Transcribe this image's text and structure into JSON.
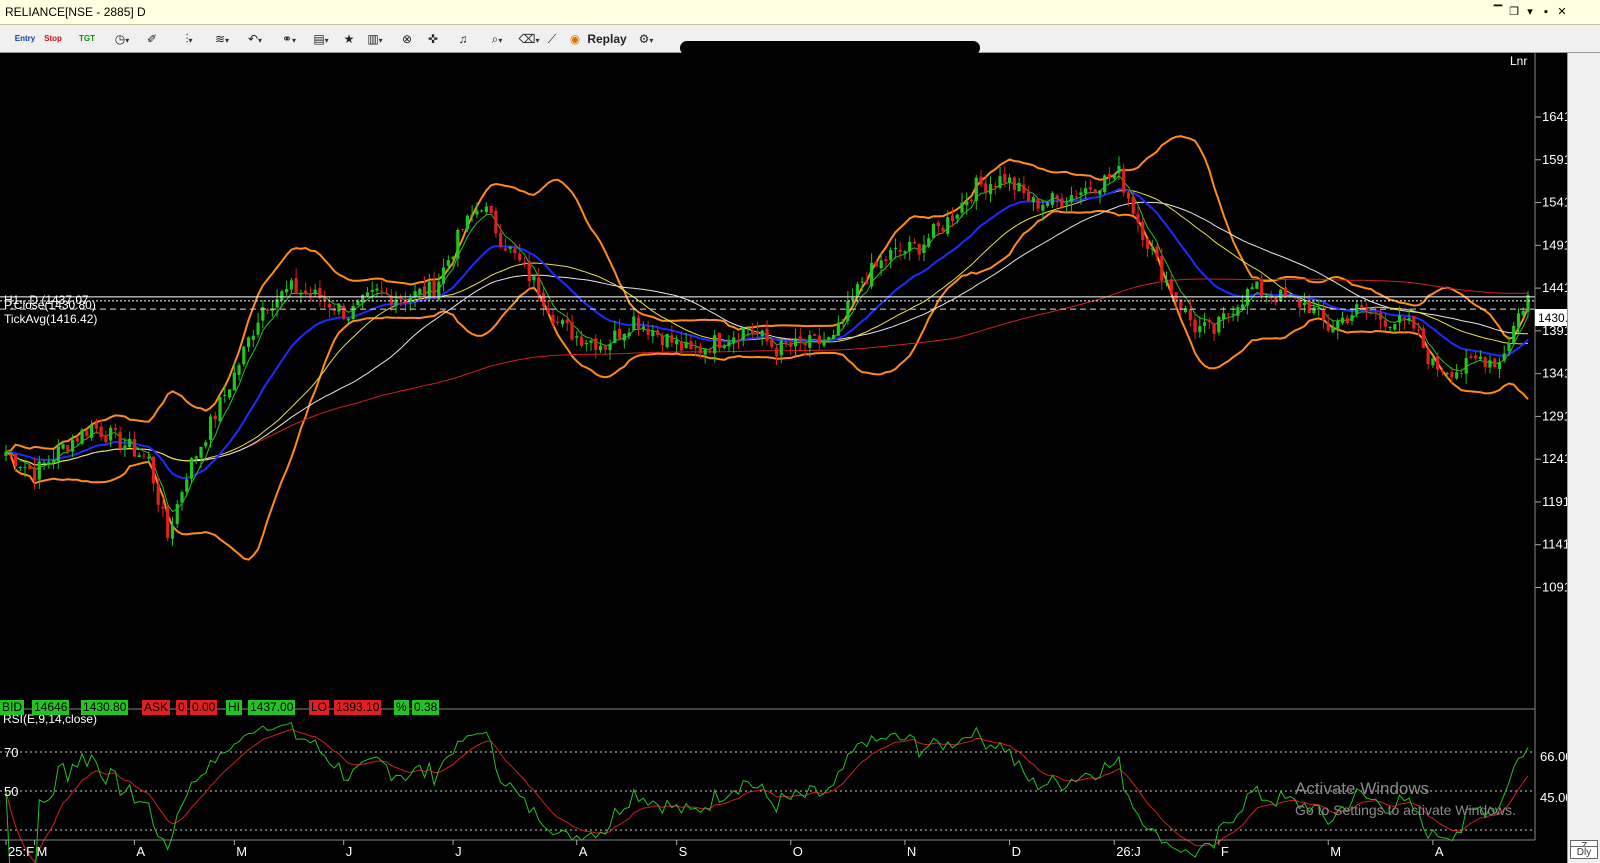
{
  "window": {
    "title": "RELIANCE[NSE - 2885] D"
  },
  "toolbar": {
    "entry_label": "Entry",
    "stop_label": "Stop",
    "tgt_label": "TGT",
    "replay_label": "Replay"
  },
  "chart_header": {
    "scale_mode": "Lnr",
    "hl_label": "H1...D (1437.07",
    "pclose_label": "P.Close(1430.80)",
    "tickavg_label": "TickAvg(1416.42)",
    "last_price_tag": "1430.80"
  },
  "quote_bar": {
    "bid_label": "BID",
    "bid_qty": "14646",
    "bid_price": "1430.80",
    "ask_label": "ASK",
    "ask_qty": "0",
    "ask_price": "0.00",
    "hi_label": "HI",
    "hi_value": "1437.00",
    "lo_label": "LO",
    "lo_value": "1393.10",
    "pct_label": "%",
    "pct_value": "0.38"
  },
  "rsi_panel": {
    "title": "RSI(E,9,14,close)",
    "left_levels": [
      "70",
      "50"
    ],
    "right_levels": [
      "66.00",
      "45.00"
    ]
  },
  "watermark": {
    "line1": "Activate Windows",
    "line2": "Go to Settings to activate Windows."
  },
  "right_strip": {
    "zoom_icon": "Z",
    "period_label": "Dly"
  },
  "colors": {
    "up_candle": "#22c322",
    "down_candle": "#e02020",
    "bollinger": "#ff8c1a",
    "ema_fast": "#1e2bff",
    "sma_long": "#d02020",
    "ma_yellow": "#e8e040",
    "ma_white": "#e6e6e6",
    "rsi_line": "#22c322",
    "rsi_signal": "#d02020"
  },
  "chart_data": {
    "type": "candlestick",
    "symbol": "RELIANCE",
    "timeframe": "Daily",
    "price_axis_ticks": [
      1641,
      1591,
      1541,
      1491,
      1441,
      1391,
      1341,
      1291,
      1241,
      1191,
      1141,
      1091
    ],
    "price_axis_labels": [
      "1641.00",
      "1591.00",
      "1541.00",
      "1491.00",
      "1441.00",
      "1391.00",
      "1341.00",
      "1291.00",
      "1241.00",
      "1191.00",
      "1141.00",
      "1091.00"
    ],
    "ylim": [
      1030,
      1700
    ],
    "time_axis_labels": [
      "25:F",
      "M",
      "A",
      "M",
      "J",
      "J",
      "A",
      "S",
      "O",
      "N",
      "D",
      "26:J",
      "F",
      "M",
      "A"
    ],
    "time_axis_label_index": [
      0,
      6,
      27,
      48,
      71,
      94,
      120,
      141,
      165,
      189,
      211,
      233,
      255,
      278,
      300
    ],
    "close_path": [
      [
        0,
        1250
      ],
      [
        6,
        1225
      ],
      [
        12,
        1255
      ],
      [
        18,
        1280
      ],
      [
        24,
        1262
      ],
      [
        30,
        1240
      ],
      [
        34,
        1150
      ],
      [
        38,
        1225
      ],
      [
        42,
        1270
      ],
      [
        48,
        1340
      ],
      [
        54,
        1420
      ],
      [
        60,
        1440
      ],
      [
        66,
        1430
      ],
      [
        72,
        1410
      ],
      [
        78,
        1435
      ],
      [
        84,
        1430
      ],
      [
        90,
        1440
      ],
      [
        96,
        1510
      ],
      [
        100,
        1540
      ],
      [
        104,
        1500
      ],
      [
        108,
        1470
      ],
      [
        112,
        1440
      ],
      [
        116,
        1400
      ],
      [
        120,
        1385
      ],
      [
        126,
        1375
      ],
      [
        132,
        1405
      ],
      [
        138,
        1385
      ],
      [
        144,
        1365
      ],
      [
        150,
        1380
      ],
      [
        156,
        1395
      ],
      [
        162,
        1370
      ],
      [
        168,
        1375
      ],
      [
        174,
        1380
      ],
      [
        180,
        1450
      ],
      [
        186,
        1480
      ],
      [
        192,
        1490
      ],
      [
        198,
        1520
      ],
      [
        204,
        1560
      ],
      [
        210,
        1570
      ],
      [
        216,
        1540
      ],
      [
        222,
        1545
      ],
      [
        228,
        1560
      ],
      [
        234,
        1575
      ],
      [
        238,
        1520
      ],
      [
        242,
        1470
      ],
      [
        246,
        1430
      ],
      [
        250,
        1395
      ],
      [
        254,
        1390
      ],
      [
        258,
        1420
      ],
      [
        262,
        1440
      ],
      [
        268,
        1430
      ],
      [
        274,
        1420
      ],
      [
        278,
        1395
      ],
      [
        284,
        1415
      ],
      [
        290,
        1405
      ],
      [
        296,
        1395
      ],
      [
        300,
        1350
      ],
      [
        306,
        1345
      ],
      [
        310,
        1360
      ],
      [
        314,
        1355
      ],
      [
        318,
        1410
      ],
      [
        320,
        1431
      ]
    ],
    "last_close": 1430.8,
    "prev_close": 1430.8,
    "rsi": {
      "levels": [
        70,
        50,
        30
      ],
      "right_axis_labels": [
        "66.00",
        "45.00"
      ]
    }
  }
}
